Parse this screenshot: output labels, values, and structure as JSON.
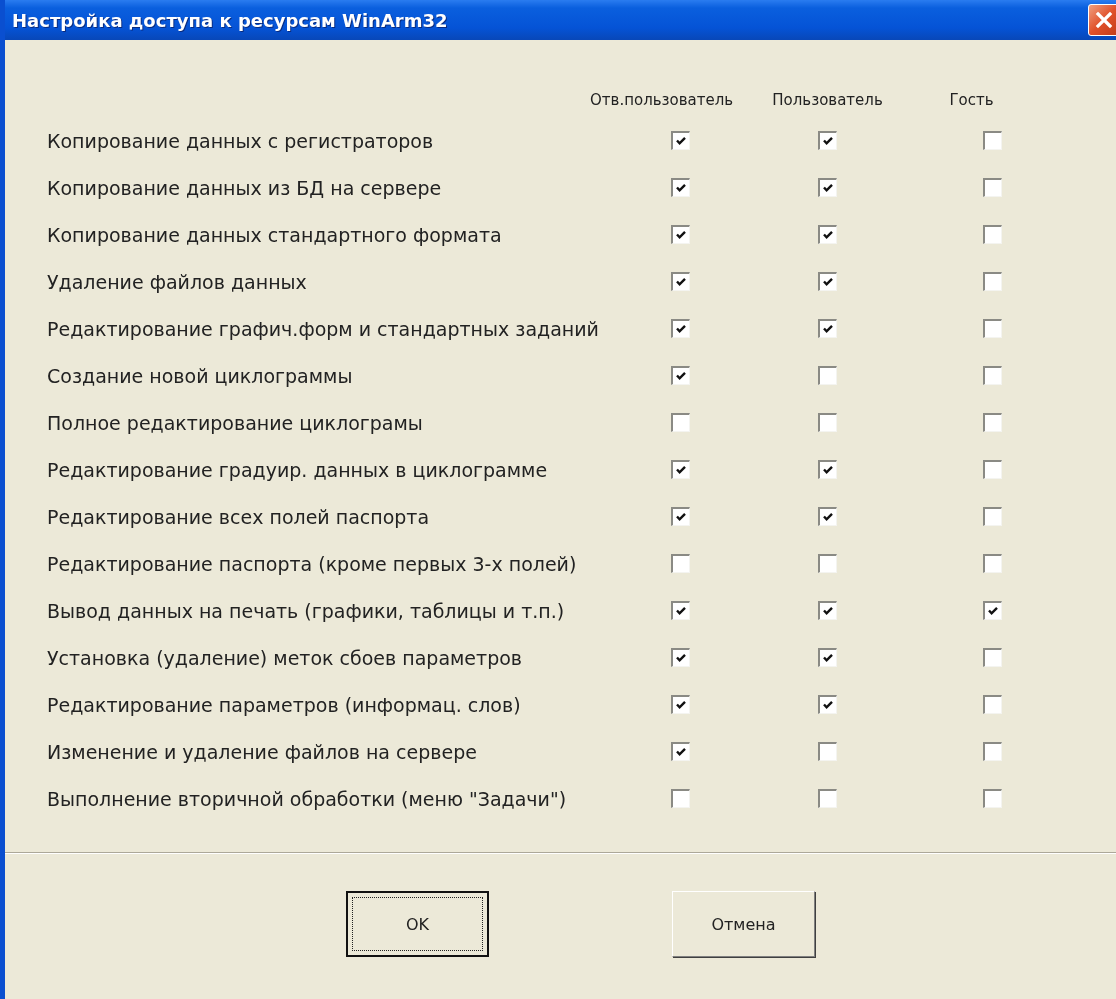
{
  "window": {
    "title": "Настройка доступа к ресурсам WinArm32"
  },
  "columns": [
    "Отв.пользователь",
    "Пользователь",
    "Гость"
  ],
  "rows": [
    {
      "label": "Копирование данных с регистраторов",
      "checks": [
        {
          "checked": true
        },
        {
          "checked": true
        },
        {
          "checked": false
        }
      ]
    },
    {
      "label": "Копирование данных из БД на сервере",
      "checks": [
        {
          "checked": true
        },
        {
          "checked": true
        },
        {
          "checked": false
        }
      ]
    },
    {
      "label": "Копирование данных стандартного формата",
      "checks": [
        {
          "checked": true
        },
        {
          "checked": true
        },
        {
          "checked": false
        }
      ]
    },
    {
      "label": "Удаление файлов данных",
      "checks": [
        {
          "checked": true
        },
        {
          "checked": true
        },
        {
          "checked": false
        }
      ]
    },
    {
      "label": "Редактирование графич.форм и стандартных заданий",
      "checks": [
        {
          "checked": true
        },
        {
          "checked": true
        },
        {
          "checked": false
        }
      ]
    },
    {
      "label": "Создание новой циклограммы",
      "checks": [
        {
          "checked": true
        },
        {
          "checked": false
        },
        {
          "checked": false
        }
      ]
    },
    {
      "label": "Полное редактирование циклограмы",
      "checks": [
        {
          "checked": false
        },
        {
          "checked": false
        },
        {
          "checked": false
        }
      ]
    },
    {
      "label": "Редактирование градуир. данных в циклограмме",
      "checks": [
        {
          "checked": true
        },
        {
          "checked": true
        },
        {
          "checked": false
        }
      ]
    },
    {
      "label": "Редактирование всех полей паспорта",
      "checks": [
        {
          "checked": true
        },
        {
          "checked": true
        },
        {
          "checked": false
        }
      ]
    },
    {
      "label": "Редактирование паспорта  (кроме первых 3-х полей)",
      "checks": [
        {
          "checked": false
        },
        {
          "checked": false
        },
        {
          "checked": false
        }
      ]
    },
    {
      "label": "Вывод данных на печать (графики, таблицы и т.п.)",
      "checks": [
        {
          "checked": true
        },
        {
          "checked": true
        },
        {
          "checked": true
        }
      ]
    },
    {
      "label": "Установка (удаление)   меток сбоев параметров",
      "checks": [
        {
          "checked": true
        },
        {
          "checked": true
        },
        {
          "checked": false
        }
      ]
    },
    {
      "label": "Редактирование параметров (информац. слов)",
      "checks": [
        {
          "checked": true
        },
        {
          "checked": true
        },
        {
          "checked": false
        }
      ]
    },
    {
      "label": "Изменение и удаление файлов на сервере",
      "checks": [
        {
          "checked": true
        },
        {
          "checked": false
        },
        {
          "checked": false
        }
      ]
    },
    {
      "label": "Выполнение вторичной обработки (меню \"Задачи\")",
      "checks": [
        {
          "checked": false
        },
        {
          "checked": false
        },
        {
          "checked": false
        }
      ]
    }
  ],
  "buttons": [
    {
      "label": "OK",
      "default": true
    },
    {
      "label": "Отмена",
      "default": false
    }
  ]
}
